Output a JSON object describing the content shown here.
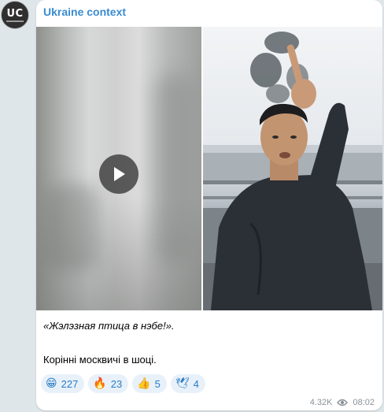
{
  "channel": {
    "avatar_text": "UC",
    "name": "Ukraine context"
  },
  "post": {
    "caption_quote": "«Жэлэзная птица в нэбе!».",
    "caption_text": "Корінні москвичі в шоці.",
    "reactions": [
      {
        "emoji": "😁",
        "count": "227"
      },
      {
        "emoji": "🔥",
        "count": "23"
      },
      {
        "emoji": "👍",
        "count": "5"
      },
      {
        "emoji": "🕊",
        "count": "4"
      }
    ],
    "views": "4.32K",
    "time": "08:02"
  },
  "icons": {
    "play": "play-icon",
    "views": "eye-icon"
  },
  "colors": {
    "accent": "#3a8bd0",
    "reaction_bg": "#e8f1fa",
    "meta": "#8b9298"
  }
}
